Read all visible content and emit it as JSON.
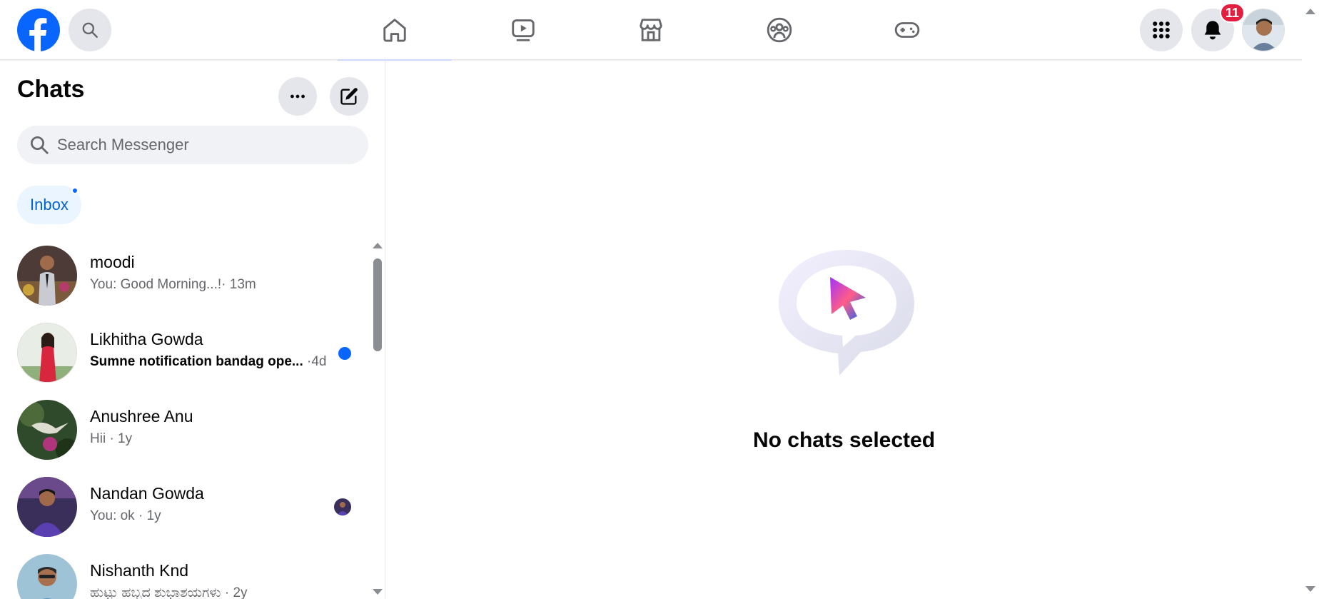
{
  "header": {
    "brand": "facebook",
    "nav_tabs": [
      {
        "name": "home-icon",
        "active": true
      },
      {
        "name": "video-icon",
        "active": false
      },
      {
        "name": "marketplace-icon",
        "active": false
      },
      {
        "name": "groups-icon",
        "active": false
      },
      {
        "name": "gaming-icon",
        "active": false
      }
    ],
    "notification_count": "11"
  },
  "sidebar": {
    "title": "Chats",
    "search_placeholder": "Search Messenger",
    "inbox_label": "Inbox",
    "chats": [
      {
        "name": "moodi",
        "preview": "You: Good Morning...!",
        "time": "· 13m",
        "unread": false,
        "indicator": "none"
      },
      {
        "name": "Likhitha Gowda",
        "preview": "Sumne notification bandag ope...",
        "time": " ·4d",
        "unread": true,
        "indicator": "unread-dot"
      },
      {
        "name": "Anushree Anu",
        "preview": "Hii",
        "time": " · 1y",
        "unread": false,
        "indicator": "none"
      },
      {
        "name": "Nandan Gowda",
        "preview": "You: ok",
        "time": " · 1y",
        "unread": false,
        "indicator": "seen-avatar"
      },
      {
        "name": "Nishanth Knd",
        "preview": "ಹುಟ್ಟು ಹಬ್ಬದ ಶುಭಾಶಯಗಳು",
        "time": " · 2y",
        "unread": false,
        "indicator": "none"
      }
    ]
  },
  "main": {
    "empty_title": "No chats selected"
  },
  "colors": {
    "brand_blue": "#0866ff",
    "badge_red": "#e41e3f",
    "secondary_text": "#65676b",
    "button_gray": "#e4e6eb"
  }
}
